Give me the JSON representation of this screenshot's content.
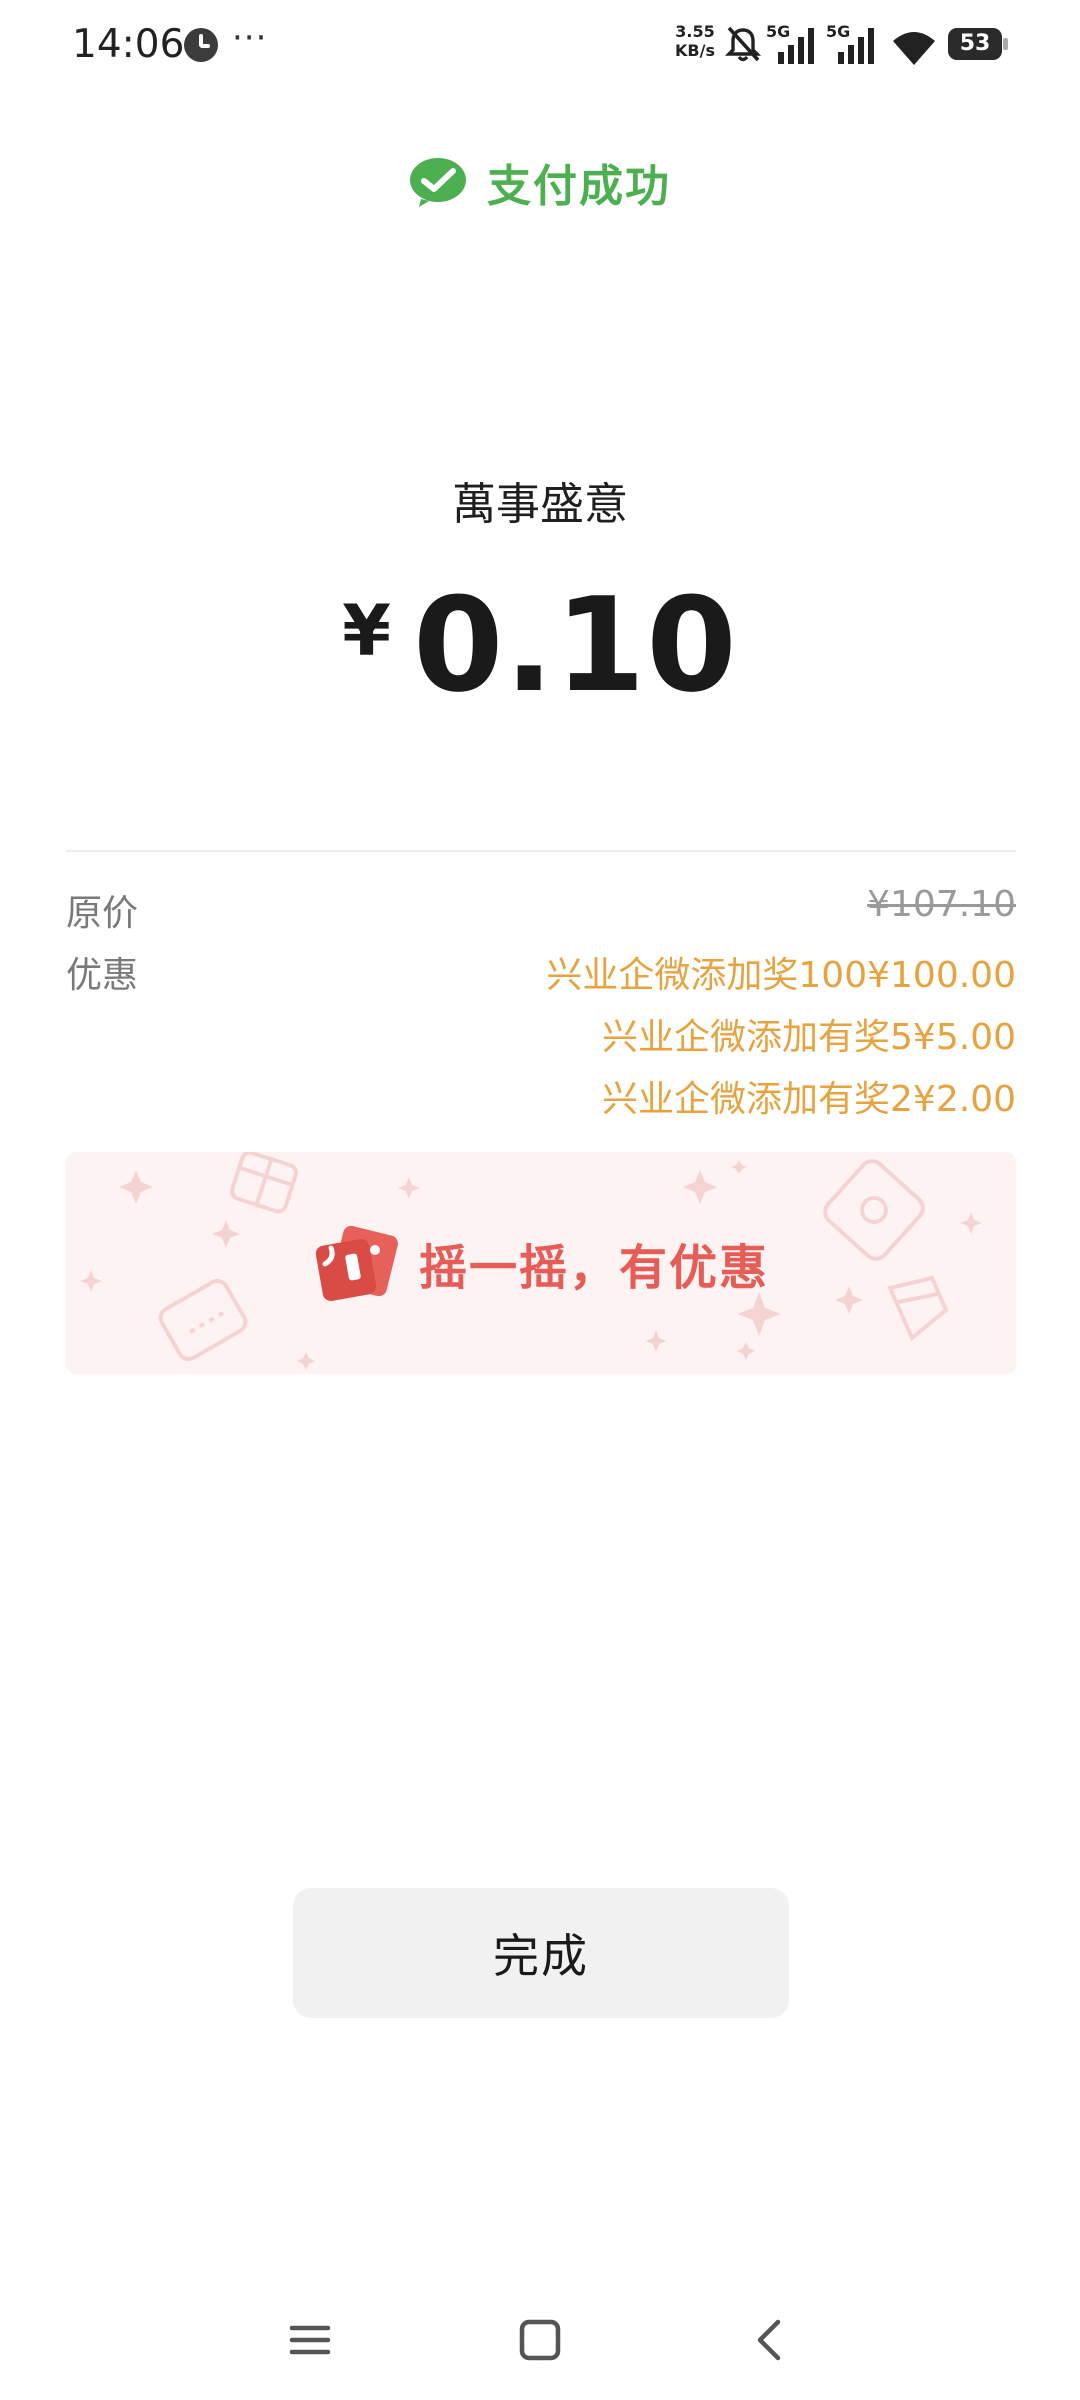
{
  "status_bar": {
    "time": "14:06",
    "more": "···",
    "net_speed_value": "3.55",
    "net_speed_unit": "KB/s",
    "signal_1_label": "5G",
    "signal_2_label": "5G",
    "battery": "53"
  },
  "header": {
    "title": "支付成功",
    "icon": "wechat-pay-check-icon",
    "accent_color": "#4caf50"
  },
  "payment": {
    "merchant": "萬事盛意",
    "currency_symbol": "¥",
    "amount": "0.10"
  },
  "details": {
    "original_label": "原价",
    "original_value": "¥107.10",
    "discount_label": "优惠",
    "discounts": [
      "兴业企微添加奖100¥100.00",
      "兴业企微添加有奖5¥5.00",
      "兴业企微添加有奖2¥2.00"
    ],
    "discount_color": "#e7a33f"
  },
  "banner": {
    "text": "摇一摇，有优惠",
    "icon": "shake-coupon-icon",
    "text_color": "#e65c57"
  },
  "done_button": {
    "label": "完成"
  },
  "nav_bar": {
    "items": [
      "menu-icon",
      "home-icon",
      "back-icon"
    ]
  }
}
